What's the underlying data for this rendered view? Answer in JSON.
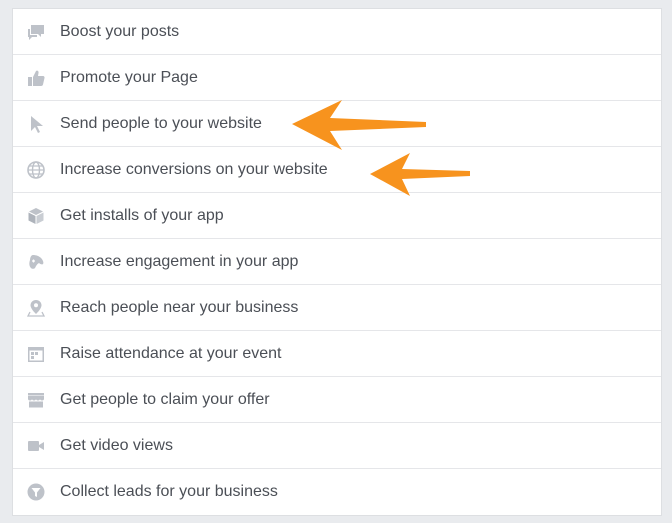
{
  "objectives": [
    {
      "label": "Boost your posts",
      "icon": "speech-bubbles-icon"
    },
    {
      "label": "Promote your Page",
      "icon": "thumbs-up-icon"
    },
    {
      "label": "Send people to your website",
      "icon": "cursor-icon"
    },
    {
      "label": "Increase conversions on your website",
      "icon": "globe-icon"
    },
    {
      "label": "Get installs of your app",
      "icon": "cube-icon"
    },
    {
      "label": "Increase engagement in your app",
      "icon": "gamepad-icon"
    },
    {
      "label": "Reach people near your business",
      "icon": "location-pin-icon"
    },
    {
      "label": "Raise attendance at your event",
      "icon": "calendar-icon"
    },
    {
      "label": "Get people to claim your offer",
      "icon": "storefront-icon"
    },
    {
      "label": "Get video views",
      "icon": "video-camera-icon"
    },
    {
      "label": "Collect leads for your business",
      "icon": "funnel-icon"
    }
  ],
  "colors": {
    "icon": "#bec2c9",
    "text": "#4b4f56",
    "arrow": "#f7931e"
  }
}
